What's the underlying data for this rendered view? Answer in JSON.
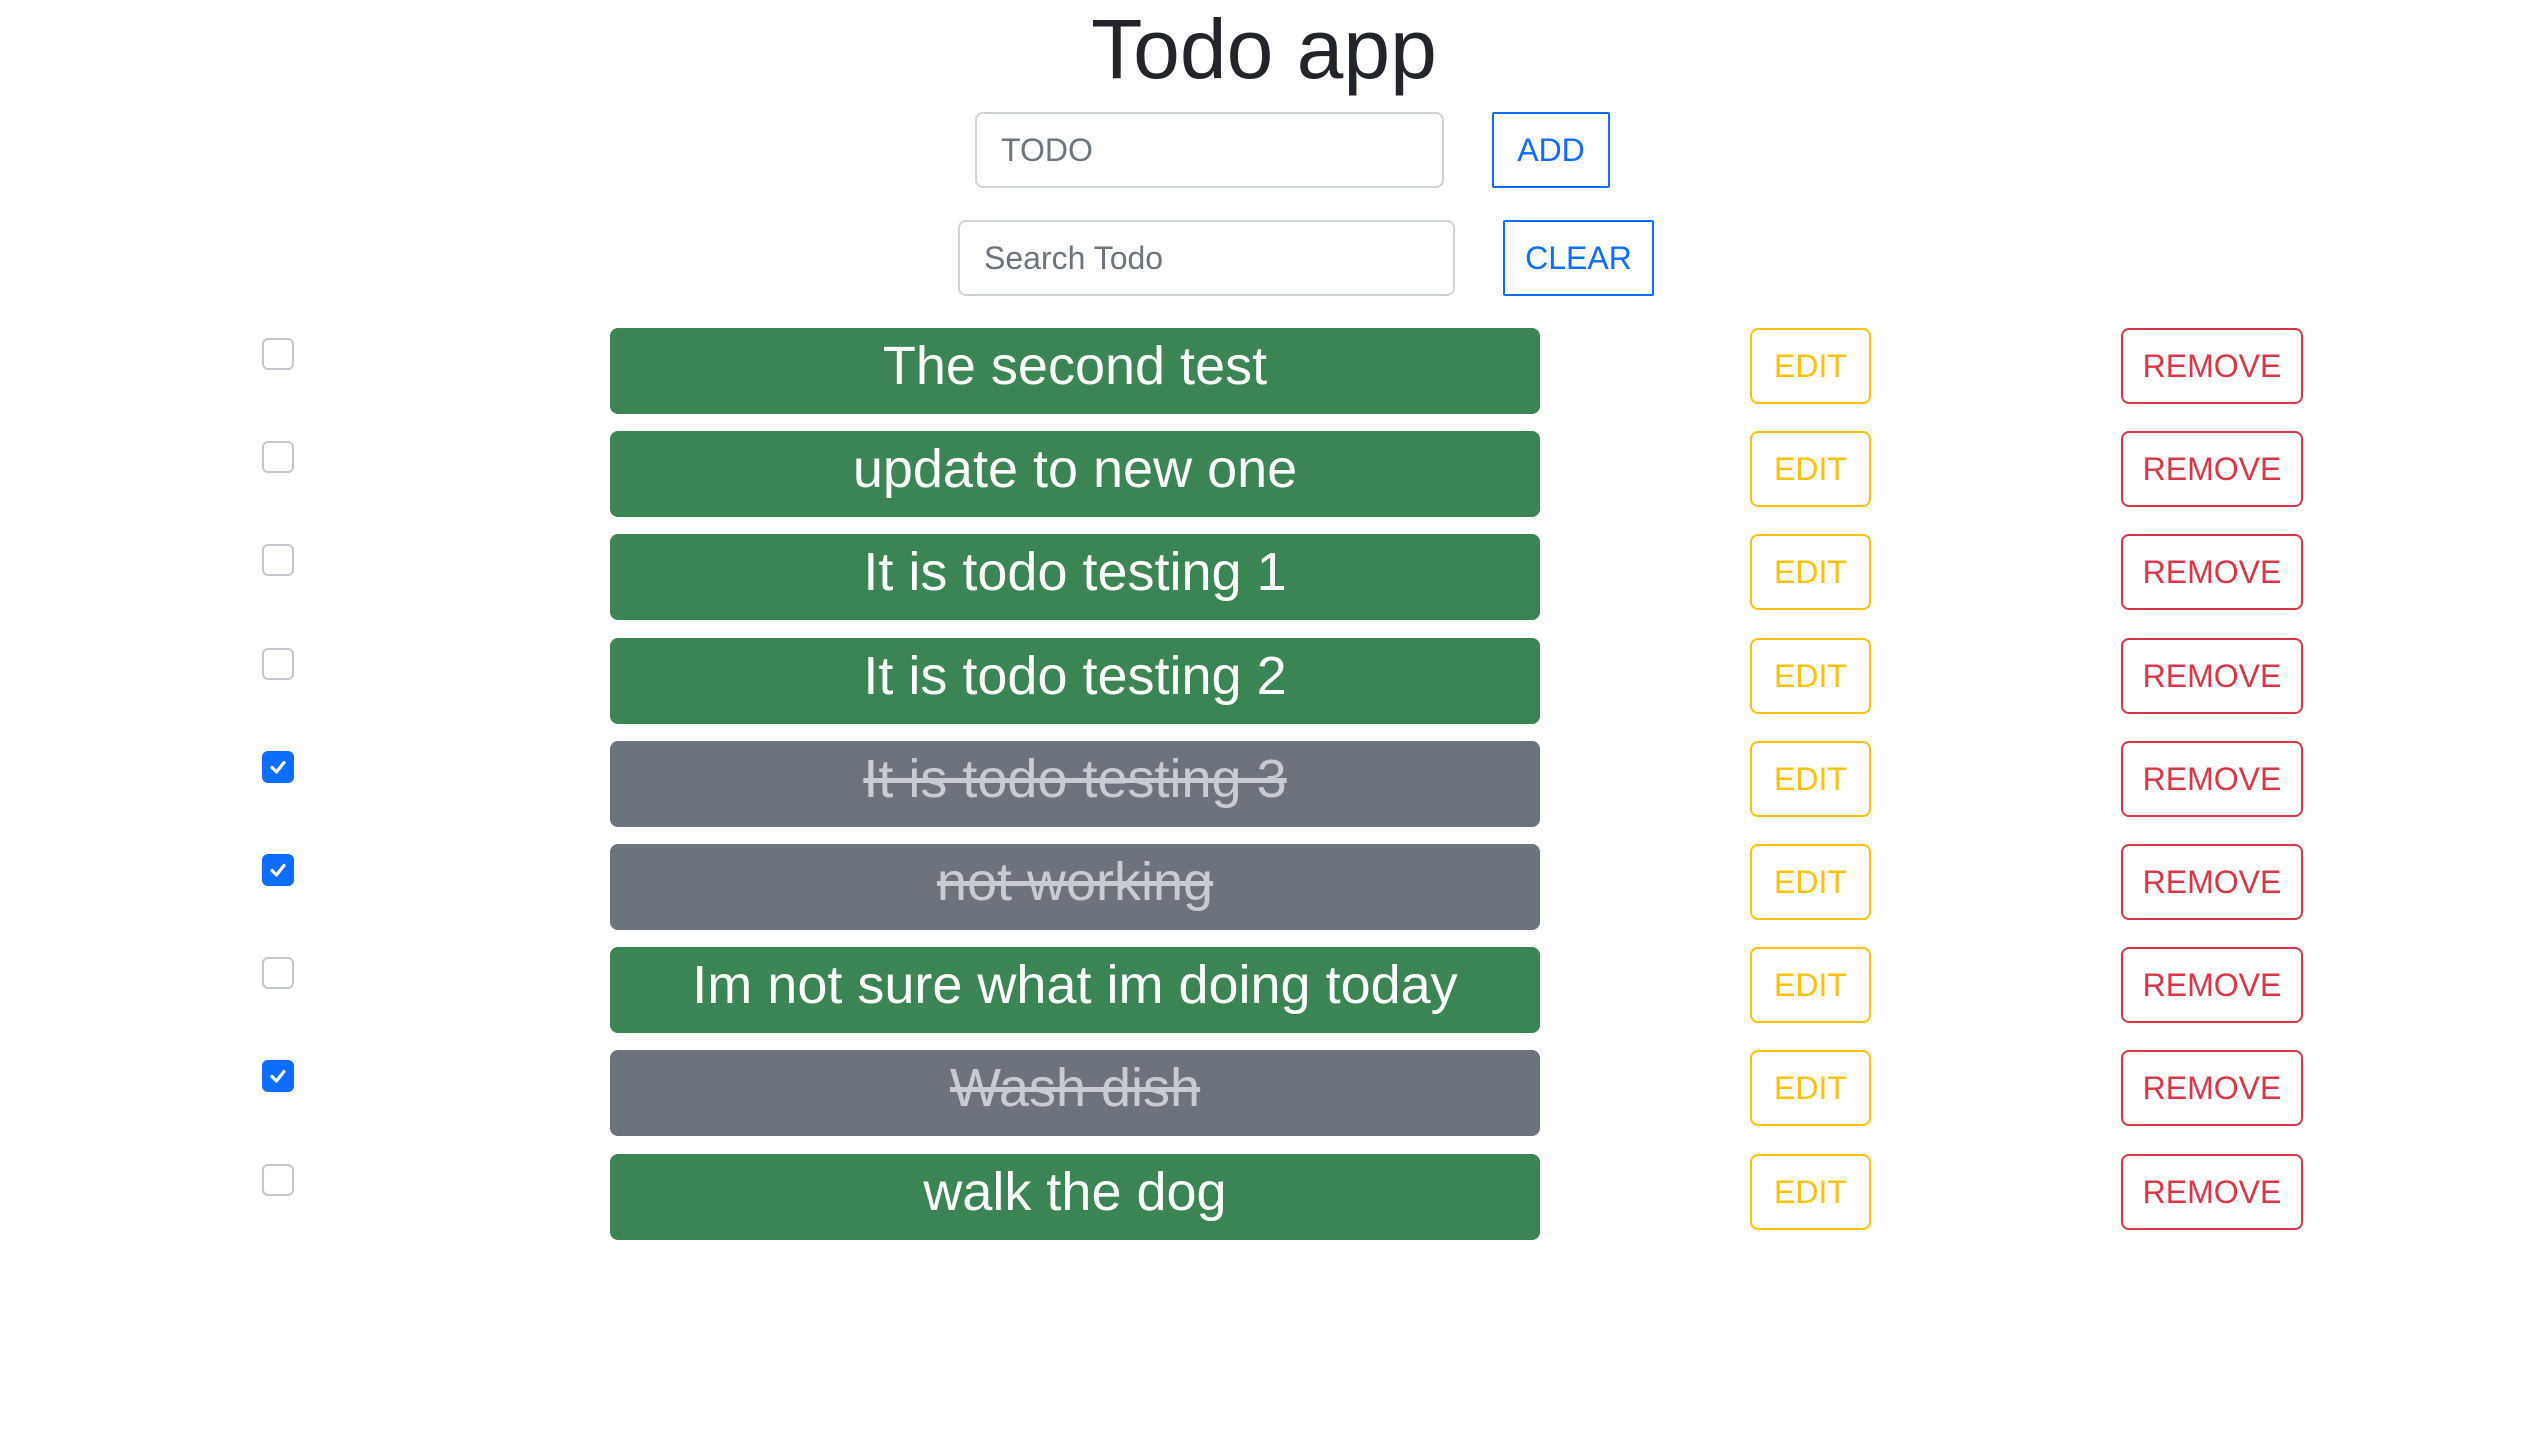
{
  "app": {
    "title": "Todo app"
  },
  "add_form": {
    "placeholder": "TODO",
    "value": "",
    "add_label": "ADD"
  },
  "search_form": {
    "placeholder": "Search Todo",
    "value": "",
    "clear_label": "CLEAR"
  },
  "todos": [
    {
      "text": "The second test",
      "completed": false,
      "edit_label": "EDIT",
      "remove_label": "REMOVE"
    },
    {
      "text": "update to new one",
      "completed": false,
      "edit_label": "EDIT",
      "remove_label": "REMOVE"
    },
    {
      "text": "It is todo testing 1",
      "completed": false,
      "edit_label": "EDIT",
      "remove_label": "REMOVE"
    },
    {
      "text": "It is todo testing 2",
      "completed": false,
      "edit_label": "EDIT",
      "remove_label": "REMOVE"
    },
    {
      "text": "It is todo testing 3",
      "completed": true,
      "edit_label": "EDIT",
      "remove_label": "REMOVE"
    },
    {
      "text": "not working",
      "completed": true,
      "edit_label": "EDIT",
      "remove_label": "REMOVE"
    },
    {
      "text": "Im not sure what im doing today",
      "completed": false,
      "edit_label": "EDIT",
      "remove_label": "REMOVE"
    },
    {
      "text": "Wash dish",
      "completed": true,
      "edit_label": "EDIT",
      "remove_label": "REMOVE"
    },
    {
      "text": "walk the dog",
      "completed": false,
      "edit_label": "EDIT",
      "remove_label": "REMOVE"
    }
  ],
  "icons": {
    "checkbox_check": "check-icon"
  },
  "colors": {
    "active_item": "#3a8553",
    "completed_item": "#6c737d",
    "primary": "#0d6efd",
    "edit": "#ffc107",
    "remove": "#dc3545"
  }
}
